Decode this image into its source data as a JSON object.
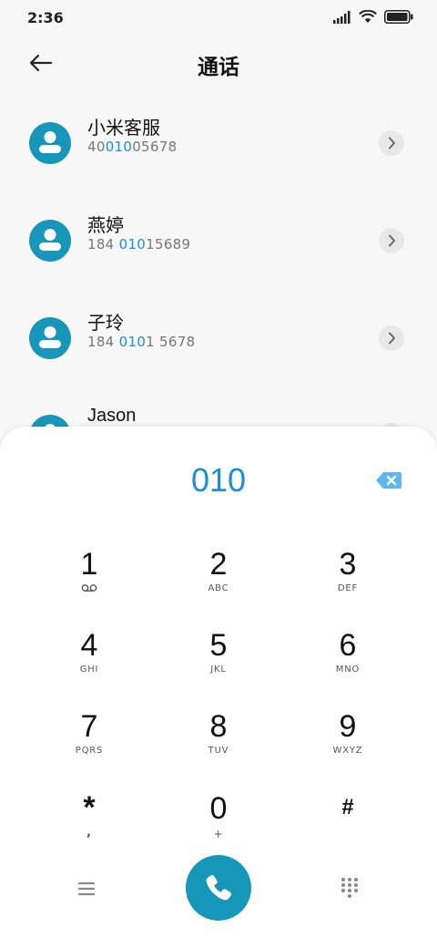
{
  "status": {
    "time": "2:36"
  },
  "header": {
    "title": "通话"
  },
  "contacts": [
    {
      "name": "小米客服",
      "number_parts": [
        "40",
        "010",
        "05678"
      ]
    },
    {
      "name": "燕婷",
      "number_parts": [
        "184 ",
        "010",
        "15689"
      ]
    },
    {
      "name": "子玲",
      "number_parts": [
        "184 ",
        "010",
        "1 5678"
      ]
    },
    {
      "name": "Jason"
    }
  ],
  "dialpad": {
    "value": "010",
    "keys": [
      {
        "digit": "1",
        "letters": "",
        "sub_icon": "voicemail-icon"
      },
      {
        "digit": "2",
        "letters": "ABC"
      },
      {
        "digit": "3",
        "letters": "DEF"
      },
      {
        "digit": "4",
        "letters": "GHI"
      },
      {
        "digit": "5",
        "letters": "JKL"
      },
      {
        "digit": "6",
        "letters": "MNO"
      },
      {
        "digit": "7",
        "letters": "PQRS"
      },
      {
        "digit": "8",
        "letters": "TUV"
      },
      {
        "digit": "9",
        "letters": "WXYZ"
      },
      {
        "digit": "*",
        "letters": ","
      },
      {
        "digit": "0",
        "letters": "+"
      },
      {
        "digit": "#",
        "letters": ""
      }
    ]
  },
  "colors": {
    "accent": "#1a8fd8",
    "call_button": "#1696b9",
    "avatar": "#1696b9"
  }
}
